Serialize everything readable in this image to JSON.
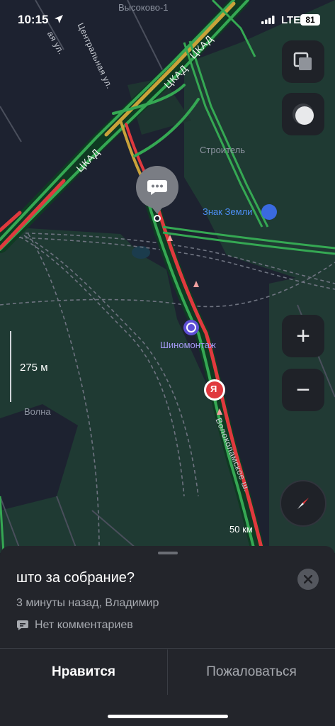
{
  "status_bar": {
    "time": "10:15",
    "network": "LTE",
    "battery": "81"
  },
  "map": {
    "labels": {
      "district_top": "Высоково-1",
      "street_partial": "ая ул.",
      "street_central": "Центральная ул.",
      "ckad_1": "ЦКАД",
      "ckad_2": "ЦКАД",
      "ckad_3": "ЦКАД",
      "stroitel": "Строитель",
      "volna": "Волна",
      "volokolamsk": "Волоколамское ш."
    },
    "poi": {
      "znak_zemli": "Знак Земли",
      "shinomontazh": "Шиномонтаж",
      "yandex_marker": "Я"
    },
    "scale_label": "275 м",
    "speed_limit": "50 км",
    "controls": {
      "layers": "layers-icon",
      "theme": "theme-toggle-icon",
      "zoom_in": "+",
      "zoom_out": "−",
      "compass": "compass-icon"
    },
    "colors": {
      "traffic_green": "#35a853",
      "traffic_red": "#e0393e",
      "traffic_yellow": "#c9a23a",
      "water": "#1a3a4a"
    }
  },
  "event_card": {
    "title": "што за собрание?",
    "meta": "3 минуты назад, Владимир",
    "comments": "Нет комментариев",
    "like_label": "Нравится",
    "report_label": "Пожаловаться"
  }
}
